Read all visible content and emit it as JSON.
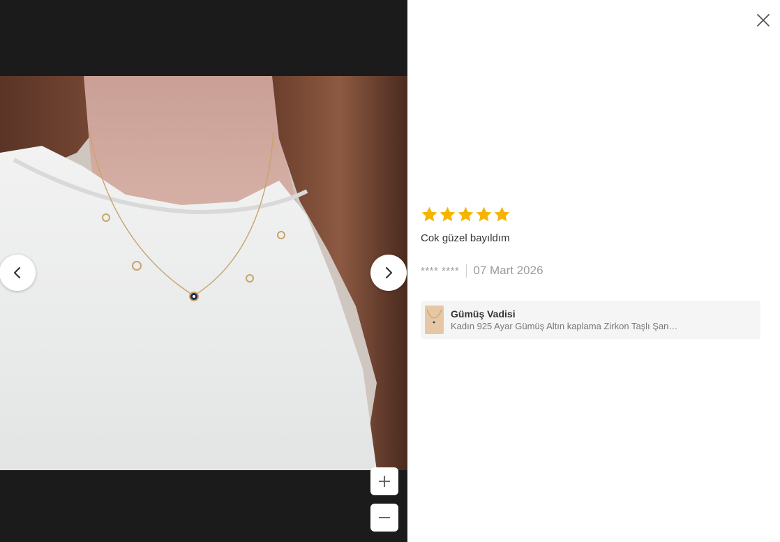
{
  "review": {
    "rating": 5,
    "max_rating": 5,
    "star_color": "#f5b400",
    "comment": "Cok güzel bayıldım",
    "author": "**** ****",
    "date": "07 Mart 2026"
  },
  "product": {
    "seller": "Gümüş Vadisi",
    "name": "Kadın 925 Ayar Gümüş Altın kaplama Zirkon Taşlı Şan…"
  },
  "icons": {
    "close": "close-icon",
    "prev": "chevron-left-icon",
    "next": "chevron-right-icon",
    "zoom_in": "plus-icon",
    "zoom_out": "minus-icon",
    "star": "star-icon"
  },
  "colors": {
    "viewer_background": "#1b1b1b",
    "card_background": "#f5f5f5",
    "meta_text": "#9b9b9b"
  }
}
